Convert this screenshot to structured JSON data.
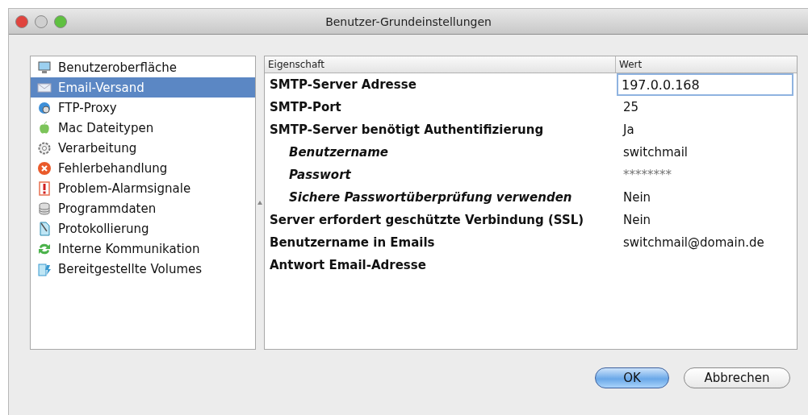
{
  "window": {
    "title": "Benutzer-Grundeinstellungen"
  },
  "sidebar": {
    "items": [
      {
        "label": "Benutzeroberfläche",
        "selected": false
      },
      {
        "label": "Email-Versand",
        "selected": true
      },
      {
        "label": "FTP-Proxy",
        "selected": false
      },
      {
        "label": "Mac Dateitypen",
        "selected": false
      },
      {
        "label": "Verarbeitung",
        "selected": false
      },
      {
        "label": "Fehlerbehandlung",
        "selected": false
      },
      {
        "label": "Problem-Alarmsignale",
        "selected": false
      },
      {
        "label": "Programmdaten",
        "selected": false
      },
      {
        "label": "Protokollierung",
        "selected": false
      },
      {
        "label": "Interne Kommunikation",
        "selected": false
      },
      {
        "label": "Bereitgestellte Volumes",
        "selected": false
      }
    ]
  },
  "table": {
    "columns": [
      "Eigenschaft",
      "Wert"
    ],
    "rows": [
      {
        "property": "SMTP-Server Adresse",
        "value": {
          "text": "197.0.0.168",
          "kind": "field"
        }
      },
      {
        "property": "SMTP-Port",
        "value": {
          "text": "25",
          "kind": "text"
        }
      },
      {
        "property": "SMTP-Server benötigt Authentifizierung",
        "value": {
          "text": "Ja",
          "kind": "text"
        },
        "children": [
          {
            "property": "Benutzername",
            "value": {
              "text": "switchmail",
              "kind": "text"
            }
          },
          {
            "property": "Passwort",
            "value": {
              "text": "********",
              "kind": "masked"
            }
          },
          {
            "property": "Sichere Passwortüberprüfung verwenden",
            "value": {
              "text": "Nein",
              "kind": "text"
            }
          }
        ]
      },
      {
        "property": "Server erfordert geschützte Verbindung (SSL)",
        "value": {
          "text": "Nein",
          "kind": "text"
        }
      },
      {
        "property": "Benutzername in Emails",
        "value": {
          "text": "switchmail@domain.de",
          "kind": "text"
        }
      },
      {
        "property": "Antwort Email-Adresse"
      }
    ]
  },
  "buttons": [
    {
      "label": "OK",
      "kind": "default"
    },
    {
      "label": "Abbrechen",
      "kind": "normal"
    }
  ]
}
